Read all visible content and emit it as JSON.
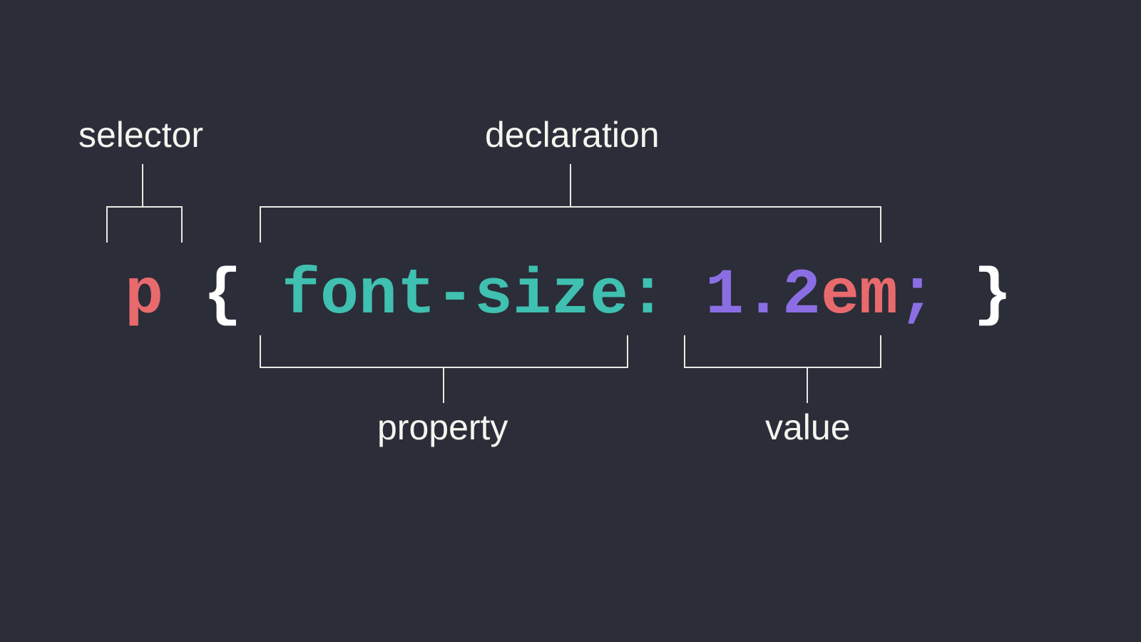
{
  "labels": {
    "selector": "selector",
    "declaration": "declaration",
    "property": "property",
    "value": "value"
  },
  "code": {
    "selector": "p",
    "open_brace": "{",
    "property": "font-size",
    "colon": ":",
    "space": " ",
    "value_number": "1.2",
    "value_unit": "em",
    "semicolon": ";",
    "close_brace": "}"
  },
  "colors": {
    "selector": "#e86a6d",
    "brace": "#ffffff",
    "property": "#3fc0b0",
    "colon": "#3fc0b0",
    "number": "#8b6ee4",
    "unit": "#e86a6d",
    "semicolon": "#8b6ee4",
    "label": "#f5f5f0",
    "background": "#2b2d38",
    "line": "#eaeae4"
  }
}
